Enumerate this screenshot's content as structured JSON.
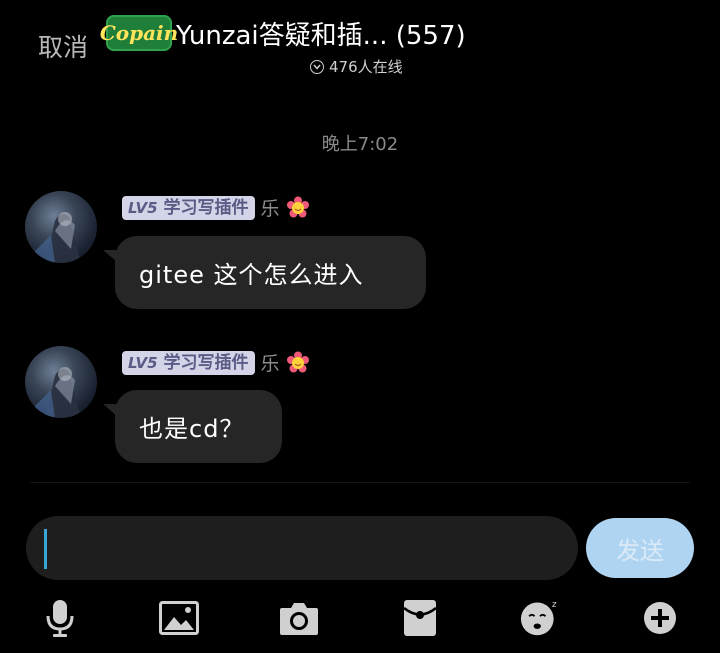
{
  "header": {
    "cancel_label": "取消",
    "logo_text": "Copain",
    "title": "Yunzai答疑和插... (557)",
    "online_text": "476人在线"
  },
  "chat": {
    "timestamp": "晚上7:02",
    "messages": [
      {
        "level": "LV5",
        "title_badge": "学习写插件",
        "nickname": "乐",
        "text": "gitee 这个怎么进入"
      },
      {
        "level": "LV5",
        "title_badge": "学习写插件",
        "nickname": "乐",
        "text": "也是cd？"
      }
    ]
  },
  "composer": {
    "input_value": "",
    "send_label": "发送"
  },
  "toolbar": {
    "icons": [
      "microphone-icon",
      "image-icon",
      "camera-icon",
      "red-packet-icon",
      "sticker-icon",
      "plus-icon"
    ]
  },
  "colors": {
    "background": "#000000",
    "bubble": "#262626",
    "send_button": "#aed4f2",
    "badge_bg": "#d4d4e8",
    "caret": "#3aa6d6"
  }
}
